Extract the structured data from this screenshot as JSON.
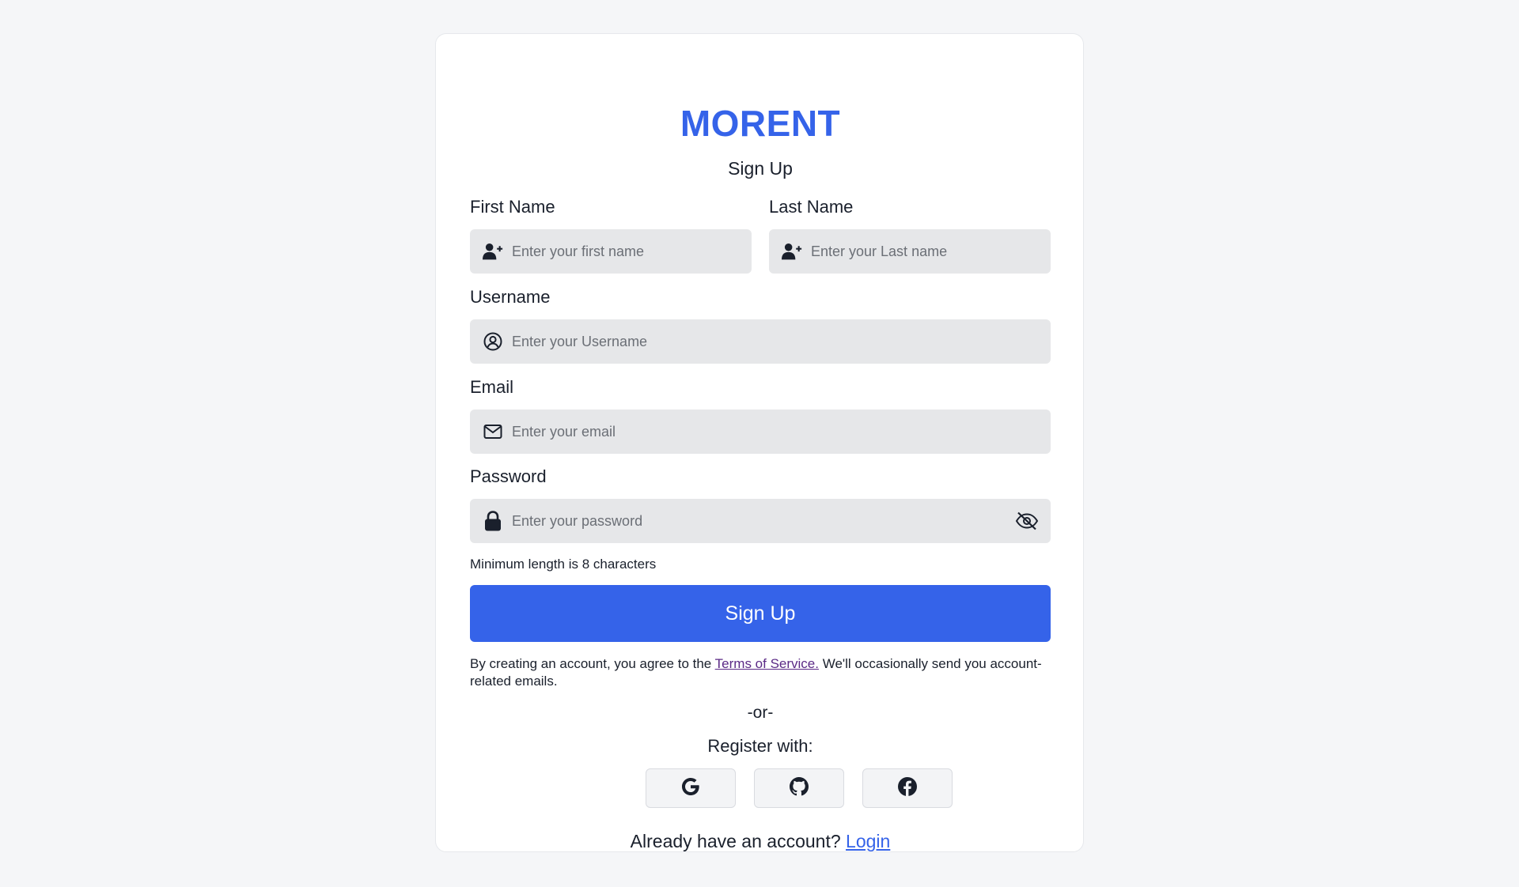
{
  "brand": "MORENT",
  "form_title": "Sign Up",
  "fields": {
    "first_name": {
      "label": "First Name",
      "placeholder": "Enter your first name",
      "value": ""
    },
    "last_name": {
      "label": "Last Name",
      "placeholder": "Enter your Last name",
      "value": ""
    },
    "username": {
      "label": "Username",
      "placeholder": "Enter your Username",
      "value": ""
    },
    "email": {
      "label": "Email",
      "placeholder": "Enter your email",
      "value": ""
    },
    "password": {
      "label": "Password",
      "placeholder": "Enter your password",
      "value": "",
      "hint": "Minimum length is 8 characters"
    }
  },
  "submit_label": "Sign Up",
  "terms": {
    "prefix": "By creating an account, you agree to the ",
    "link": "Terms of Service.",
    "suffix": " We'll occasionally send you account-related emails."
  },
  "divider": "-or-",
  "register_with": "Register with:",
  "social_providers": [
    "google-icon",
    "github-icon",
    "facebook-icon"
  ],
  "login_prompt": {
    "text": "Already have an account? ",
    "link": "Login"
  },
  "colors": {
    "accent": "#3563e9",
    "field_bg": "#e6e7e9",
    "page_bg": "#f5f6f8",
    "text": "#1a202c",
    "terms_link": "#5b2a86"
  },
  "icons": {
    "first_name": "user-plus-icon",
    "last_name": "user-plus-icon",
    "username": "user-circle-icon",
    "email": "envelope-icon",
    "password": "lock-icon",
    "password_toggle": "eye-slash-icon"
  }
}
